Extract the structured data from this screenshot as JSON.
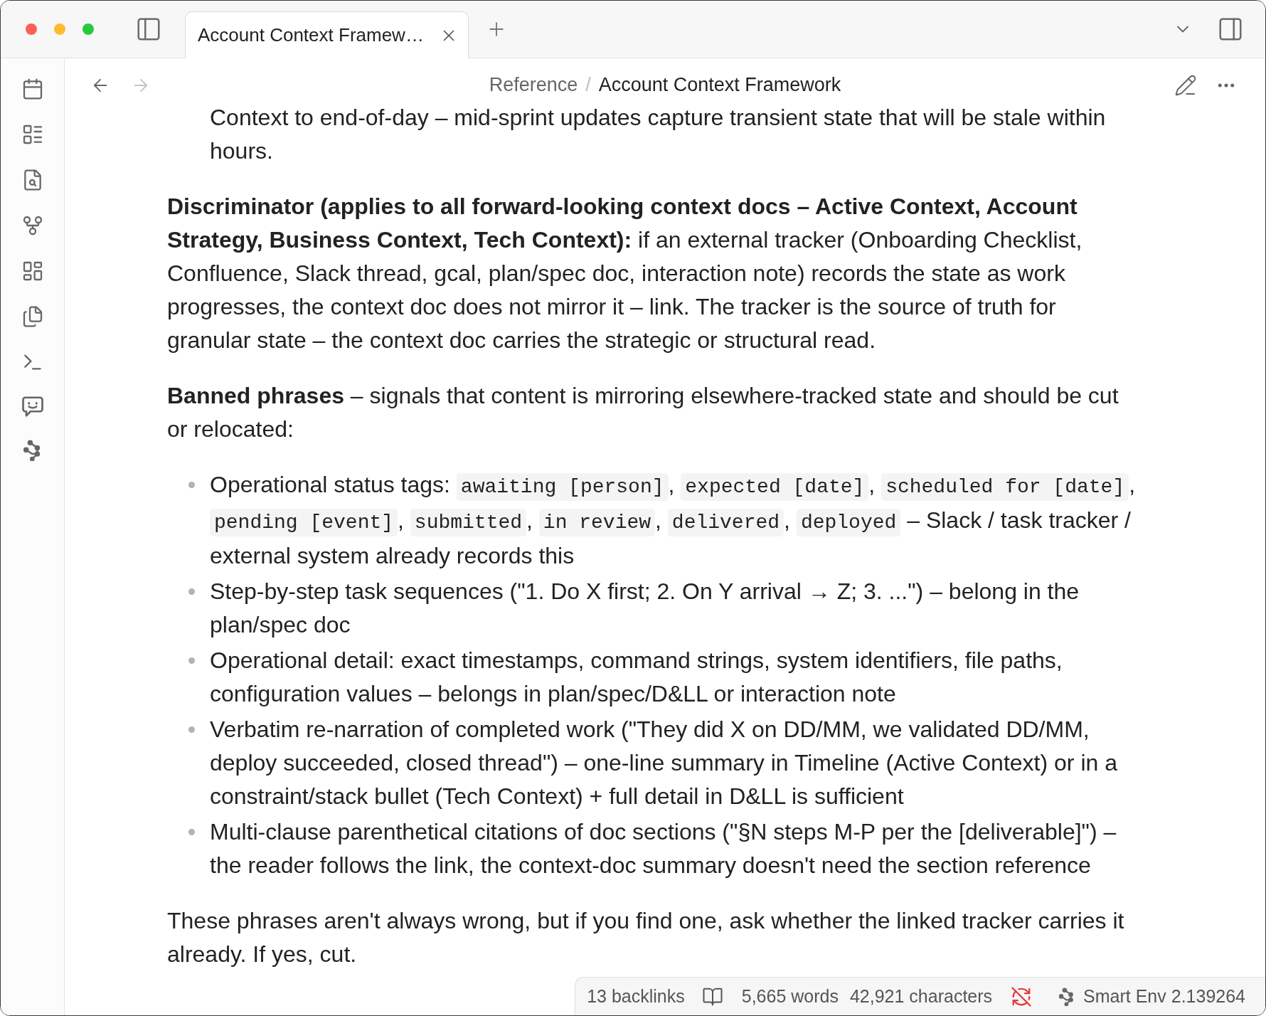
{
  "tabs": [
    {
      "title": "Account Context Framew…",
      "selected": true
    }
  ],
  "nav": {
    "back": {
      "disabled": false
    },
    "forward": {
      "disabled": true
    },
    "breadcrumb": [
      "Reference",
      "Account Context Framework"
    ],
    "separator": "/"
  },
  "document": {
    "blocks": [
      {
        "kind": "continuation",
        "text": "Context to end-of-day – mid-sprint updates capture transient state that will be stale within hours."
      },
      {
        "kind": "paragraph",
        "text": "**Discriminator (applies to all forward-looking context docs – Active Context, Account Strategy, Business Context, Tech Context):** if an external tracker (Onboarding Checklist, Confluence, Slack thread, gcal, plan/spec doc, interaction note) records the state as work progresses, the context doc does not mirror it – link. The tracker is the source of truth for granular state – the context doc carries the strategic or structural read."
      },
      {
        "kind": "paragraph",
        "text": "**Banned phrases** – signals that content is mirroring elsewhere-tracked state and should be cut or relocated:"
      },
      {
        "kind": "list",
        "items": [
          {
            "segments": [
              {
                "kind": "text",
                "text": "Operational status tags: "
              },
              {
                "kind": "code",
                "text": "awaiting [person]"
              },
              {
                "kind": "text",
                "text": ", "
              },
              {
                "kind": "code",
                "text": "expected [date]"
              },
              {
                "kind": "text",
                "text": ", "
              },
              {
                "kind": "code",
                "text": "scheduled for [date]"
              },
              {
                "kind": "text",
                "text": ", "
              },
              {
                "kind": "code",
                "text": "pending [event]"
              },
              {
                "kind": "text",
                "text": ", "
              },
              {
                "kind": "code",
                "text": "submitted"
              },
              {
                "kind": "text",
                "text": ", "
              },
              {
                "kind": "code",
                "text": "in review"
              },
              {
                "kind": "text",
                "text": ", "
              },
              {
                "kind": "code",
                "text": "delivered"
              },
              {
                "kind": "text",
                "text": ", "
              },
              {
                "kind": "code",
                "text": "deployed"
              },
              {
                "kind": "text",
                "text": " – Slack / task tracker / external system already records this"
              }
            ]
          },
          {
            "segments": [
              {
                "kind": "text",
                "text": "Step-by-step task sequences (\"1. Do X first; 2. On Y arrival → Z; 3. ...\") – belong in the plan/spec doc"
              }
            ]
          },
          {
            "segments": [
              {
                "kind": "text",
                "text": "Operational detail: exact timestamps, command strings, system identifiers, file paths, configuration values – belongs in plan/spec/D&LL or interaction note"
              }
            ]
          },
          {
            "segments": [
              {
                "kind": "text",
                "text": "Verbatim re-narration of completed work (\"They did X on DD/MM, we validated DD/MM, deploy succeeded, closed thread\") – one-line summary in Timeline (Active Context) or in a constraint/stack bullet (Tech Context) + full detail in D&LL is sufficient"
              }
            ]
          },
          {
            "segments": [
              {
                "kind": "text",
                "text": "Multi-clause parenthetical citations of doc sections (\"§N steps M-P per the [deliverable]\") – the reader follows the link, the context-doc summary doesn't need the section reference"
              }
            ]
          }
        ]
      },
      {
        "kind": "paragraph",
        "text": "These phrases aren't always wrong, but if you find one, ask whether the linked tracker carries it already. If yes, cut."
      }
    ]
  },
  "status_bar": {
    "backlinks": "13 backlinks",
    "words": "5,665 words",
    "characters": "42,921 characters",
    "plugin": "Smart Env 2.139264"
  }
}
